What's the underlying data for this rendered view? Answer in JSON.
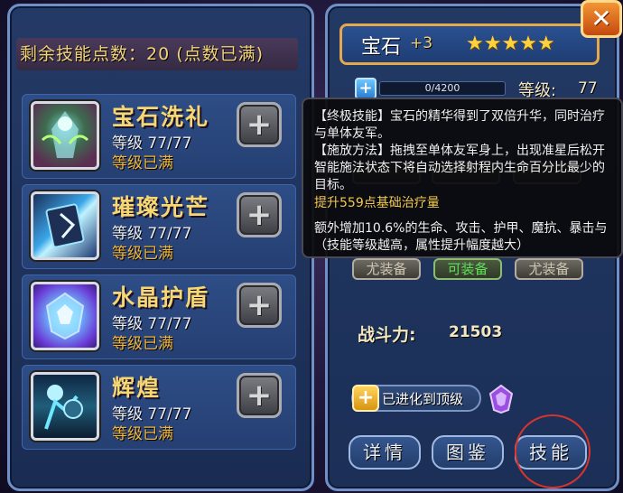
{
  "skills_panel": {
    "points_label": "剩余技能点数：20 (点数已满)",
    "skills": [
      {
        "name": "宝石洗礼",
        "level": "等级 77/77",
        "status": "等级已满",
        "icon": "skill-baptism-icon"
      },
      {
        "name": "璀璨光芒",
        "level": "等级 77/77",
        "status": "等级已满",
        "icon": "skill-radiance-icon"
      },
      {
        "name": "水晶护盾",
        "level": "等级 77/77",
        "status": "等级已满",
        "icon": "skill-crystal-shield-icon"
      },
      {
        "name": "辉煌",
        "level": "等级 77/77",
        "status": "等级已满",
        "icon": "skill-glory-icon"
      }
    ],
    "plus_button_label": "+"
  },
  "hero_panel": {
    "name": "宝石",
    "plus": "+3",
    "stars": "★★★★★",
    "close_label": "✕",
    "exp_text": "0/4200",
    "exp_plus_label": "+",
    "level_label": "等级:",
    "level_value": "77",
    "equip_slots": [
      "尤装备",
      "可装备",
      "尤装备"
    ],
    "power_label": "战斗力:",
    "power_value": "21503",
    "evolve_plus_label": "+",
    "evolve_text": "已进化到顶级",
    "tabs": [
      "详情",
      "图鉴",
      "技能"
    ]
  },
  "tooltip": {
    "line1": "【终极技能】宝石的精华得到了双倍升华，同时治疗",
    "line2": "与单体友军。",
    "line3": "【施放方法】拖拽至单体友军身上，出现准星后松开",
    "line4": "智能施法状态下将自动选择射程内生命百分比最少的",
    "line5": "目标。",
    "line6": "提升559点基础治疗量",
    "line7": "额外增加10.6%的生命、攻击、护甲、魔抗、暴击与",
    "line8": "（技能等级越高，属性提升幅度越大）"
  },
  "colors": {
    "panel_border": "#6f8fc6",
    "skill_name": "#f6d772",
    "status_orange": "#f0b53a",
    "tooltip_highlight": "#f2c94c",
    "close_orange": "#e0731f",
    "circle_red": "#d9342b"
  }
}
